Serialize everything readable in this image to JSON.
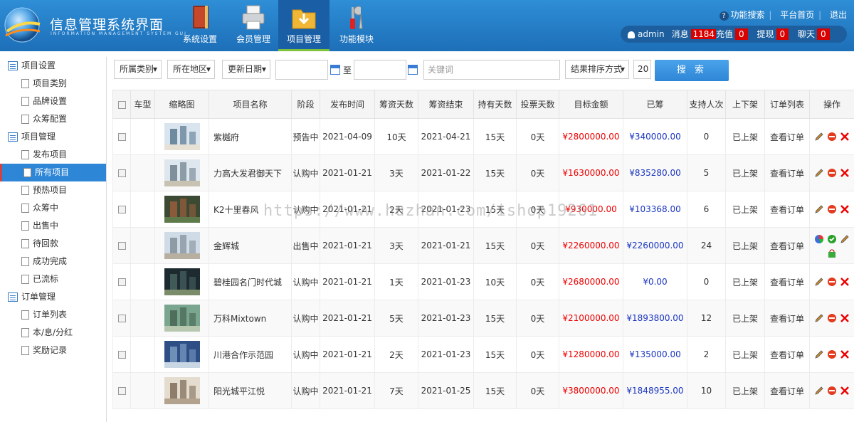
{
  "app": {
    "title": "信息管理系统界面",
    "subtitle": "INFORMATION MANAGEMENT SYSTEM GUI"
  },
  "nav": [
    {
      "label": "系统设置",
      "icon": "book-icon"
    },
    {
      "label": "会员管理",
      "icon": "printer-icon"
    },
    {
      "label": "项目管理",
      "icon": "download-folder-icon"
    },
    {
      "label": "功能模块",
      "icon": "tools-icon"
    }
  ],
  "toplinks": {
    "search": "功能搜索",
    "home": "平台首页",
    "logout": "退出"
  },
  "userbar": {
    "username": "admin",
    "msg_label": "消息",
    "msg_count": "1184",
    "recharge_label": "充值",
    "recharge_count": "0",
    "withdraw_label": "提现",
    "withdraw_count": "0",
    "chat_label": "聊天",
    "chat_count": "0"
  },
  "sidebar": {
    "groups": [
      {
        "label": "项目设置",
        "items": [
          "项目类别",
          "品牌设置",
          "众筹配置"
        ]
      },
      {
        "label": "项目管理",
        "items": [
          "发布项目",
          "所有项目",
          "预热项目",
          "众筹中",
          "出售中",
          "待回款",
          "成功完成",
          "已流标"
        ]
      },
      {
        "label": "订单管理",
        "items": [
          "订单列表",
          "本/息/分红",
          "奖励记录"
        ]
      }
    ],
    "active": "所有项目"
  },
  "filters": {
    "category": "所属类别",
    "region": "所在地区",
    "date": "更新日期",
    "to": "至",
    "keyword_placeholder": "关键词",
    "sort": "结果排序方式",
    "page_size": "20",
    "search": "搜 索"
  },
  "table": {
    "headers": [
      "",
      "车型",
      "缩略图",
      "项目名称",
      "阶段",
      "发布时间",
      "筹资天数",
      "筹资结束",
      "持有天数",
      "投票天数",
      "目标金额",
      "已筹",
      "支持人次",
      "上下架",
      "订单列表",
      "操作"
    ],
    "rows": [
      {
        "name": "紫樾府",
        "stage": "预告中",
        "publish": "2021-04-09",
        "days": "10天",
        "end": "2021-04-21",
        "hold": "15天",
        "vote": "0天",
        "target": "¥2800000.00",
        "raised": "¥340000.00",
        "supporters": "0",
        "shelf": "已上架",
        "orders": "查看订单",
        "thumb": [
          "#d9e4ef",
          "#6d8a9e",
          "#e6e1d4"
        ]
      },
      {
        "name": "力高大发君御天下",
        "stage": "认购中",
        "publish": "2021-01-21",
        "days": "3天",
        "end": "2021-01-22",
        "hold": "15天",
        "vote": "0天",
        "target": "¥1630000.00",
        "raised": "¥835280.00",
        "supporters": "5",
        "shelf": "已上架",
        "orders": "查看订单",
        "thumb": [
          "#dfe7ee",
          "#7f8f9b",
          "#c8c2b2"
        ]
      },
      {
        "name": "K2十里春风",
        "stage": "认购中",
        "publish": "2021-01-21",
        "days": "2天",
        "end": "2021-01-23",
        "hold": "15天",
        "vote": "0天",
        "target": "¥930000.00",
        "raised": "¥103368.00",
        "supporters": "6",
        "shelf": "已上架",
        "orders": "查看订单",
        "thumb": [
          "#3c4a33",
          "#8a5a3a",
          "#5f7a4a"
        ]
      },
      {
        "name": "金辉城",
        "stage": "出售中",
        "publish": "2021-01-21",
        "days": "3天",
        "end": "2021-01-21",
        "hold": "15天",
        "vote": "0天",
        "target": "¥2260000.00",
        "raised": "¥2260000.00",
        "supporters": "24",
        "shelf": "已上架",
        "orders": "查看订单",
        "thumb": [
          "#cfdbe6",
          "#8e9aa4",
          "#b7b0a0"
        ]
      },
      {
        "name": "碧桂园名门时代城",
        "stage": "认购中",
        "publish": "2021-01-21",
        "days": "1天",
        "end": "2021-01-23",
        "hold": "10天",
        "vote": "0天",
        "target": "¥2680000.00",
        "raised": "¥0.00",
        "supporters": "0",
        "shelf": "已上架",
        "orders": "查看订单",
        "thumb": [
          "#1d2a30",
          "#405a58",
          "#7b8c6a"
        ]
      },
      {
        "name": "万科Mixtown",
        "stage": "认购中",
        "publish": "2021-01-21",
        "days": "5天",
        "end": "2021-01-23",
        "hold": "15天",
        "vote": "0天",
        "target": "¥2100000.00",
        "raised": "¥1893800.00",
        "supporters": "12",
        "shelf": "已上架",
        "orders": "查看订单",
        "thumb": [
          "#7aa58e",
          "#4f6e5c",
          "#b8c8b0"
        ]
      },
      {
        "name": "川港合作示范园",
        "stage": "认购中",
        "publish": "2021-01-21",
        "days": "2天",
        "end": "2021-01-23",
        "hold": "15天",
        "vote": "0天",
        "target": "¥1280000.00",
        "raised": "¥135000.00",
        "supporters": "2",
        "shelf": "已上架",
        "orders": "查看订单",
        "thumb": [
          "#2d4f86",
          "#6e8fb8",
          "#c9d6e4"
        ]
      },
      {
        "name": "阳光城平江悦",
        "stage": "认购中",
        "publish": "2021-01-21",
        "days": "7天",
        "end": "2021-01-25",
        "hold": "15天",
        "vote": "0天",
        "target": "¥3800000.00",
        "raised": "¥1848955.00",
        "supporters": "10",
        "shelf": "已上架",
        "orders": "查看订单",
        "thumb": [
          "#e4dccf",
          "#8d7d6a",
          "#b3a38e"
        ]
      }
    ]
  },
  "watermark": "https://www.huzhan.com/ishop19261",
  "colors": {
    "header": "#2e8ed6",
    "active": "#2e86d6",
    "red": "#e00000",
    "blue": "#1a35c0",
    "badge": "#d90000",
    "accent_green": "#7ec03a"
  }
}
